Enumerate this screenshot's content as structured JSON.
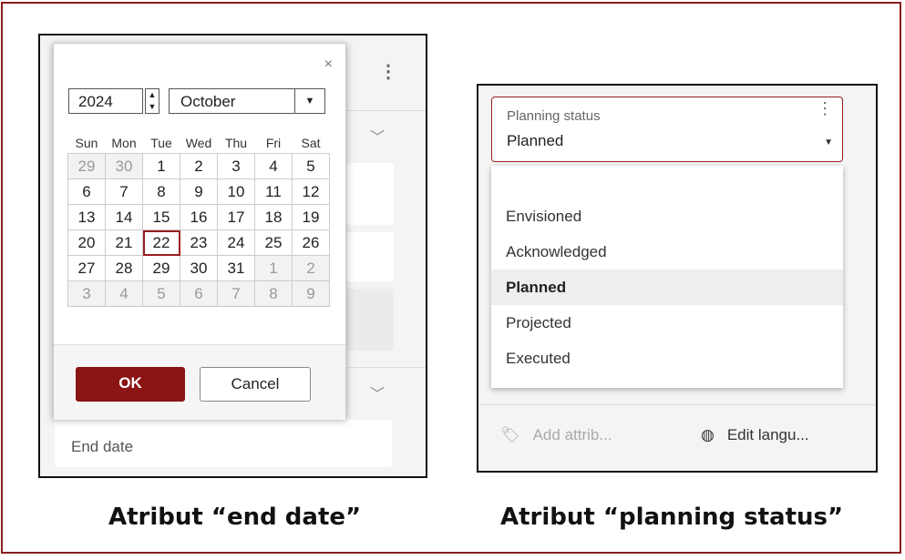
{
  "left_panel": {
    "calendar": {
      "close_glyph": "×",
      "year": "2024",
      "month": "October",
      "weekdays": [
        "Sun",
        "Mon",
        "Tue",
        "Wed",
        "Thu",
        "Fri",
        "Sat"
      ],
      "weeks": [
        [
          "29",
          "30",
          "1",
          "2",
          "3",
          "4",
          "5"
        ],
        [
          "6",
          "7",
          "8",
          "9",
          "10",
          "11",
          "12"
        ],
        [
          "13",
          "14",
          "15",
          "16",
          "17",
          "18",
          "19"
        ],
        [
          "20",
          "21",
          "22",
          "23",
          "24",
          "25",
          "26"
        ],
        [
          "27",
          "28",
          "29",
          "30",
          "31",
          "1",
          "2"
        ],
        [
          "3",
          "4",
          "5",
          "6",
          "7",
          "8",
          "9"
        ]
      ],
      "selected_day": "22",
      "ok_label": "OK",
      "cancel_label": "Cancel"
    },
    "end_date_placeholder": "End date",
    "caption": "Atribut “end date”"
  },
  "right_panel": {
    "field_label": "Planning status",
    "field_value": "Planned",
    "options": [
      "Envisioned",
      "Acknowledged",
      "Planned",
      "Projected",
      "Executed"
    ],
    "selected_option": "Planned",
    "add_attribute_label": "Add attrib...",
    "edit_language_label": "Edit langu...",
    "caption": "Atribut “planning status”"
  },
  "colors": {
    "accent": "#8b1414",
    "frame": "#8a1e1e"
  }
}
